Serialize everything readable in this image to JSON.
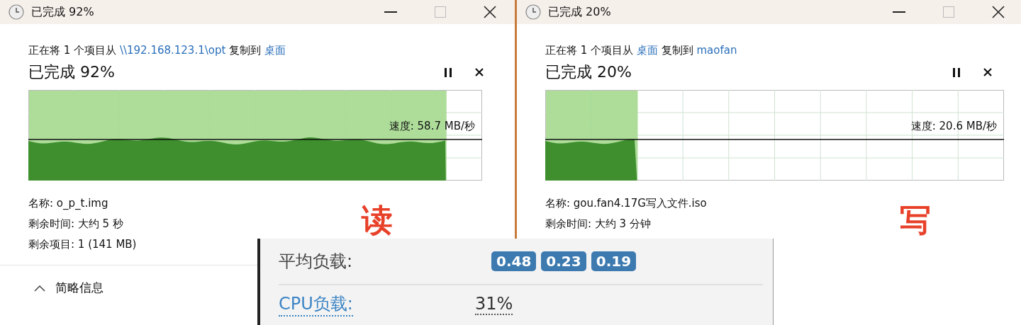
{
  "dialogs": [
    {
      "title": "已完成 92%",
      "copy_line": {
        "prefix": "正在将 1 个项目从",
        "source": "\\\\192.168.123.1\\opt",
        "middle": "复制到",
        "destination": "桌面"
      },
      "progress_text": "已完成 92%",
      "level": 0.92,
      "speed": "速度: 58.7 MB/秒",
      "details": [
        "名称: o_p_t.img",
        "剩余时间: 大约 5 秒",
        "剩余项目: 1 (141 MB)"
      ],
      "more_details": "简略信息",
      "annotation": "读"
    },
    {
      "title": "已完成 20%",
      "copy_line": {
        "prefix": "正在将 1 个项目从",
        "source": "桌面",
        "middle": "复制到",
        "destination": "maofan"
      },
      "progress_text": "已完成 20%",
      "level": 0.2,
      "speed": "速度: 20.6 MB/秒",
      "details": [
        "名称: gou.fan4.17G写入文件.iso",
        "剩余时间: 大约 3 分钟"
      ],
      "annotation": "写"
    }
  ],
  "load_panel": {
    "rows": [
      {
        "kind": "badges",
        "label": "平均负载:",
        "values": [
          "0.48",
          "0.23",
          "0.19"
        ]
      },
      {
        "kind": "link",
        "label": "CPU负载:",
        "value": "31%"
      }
    ]
  }
}
